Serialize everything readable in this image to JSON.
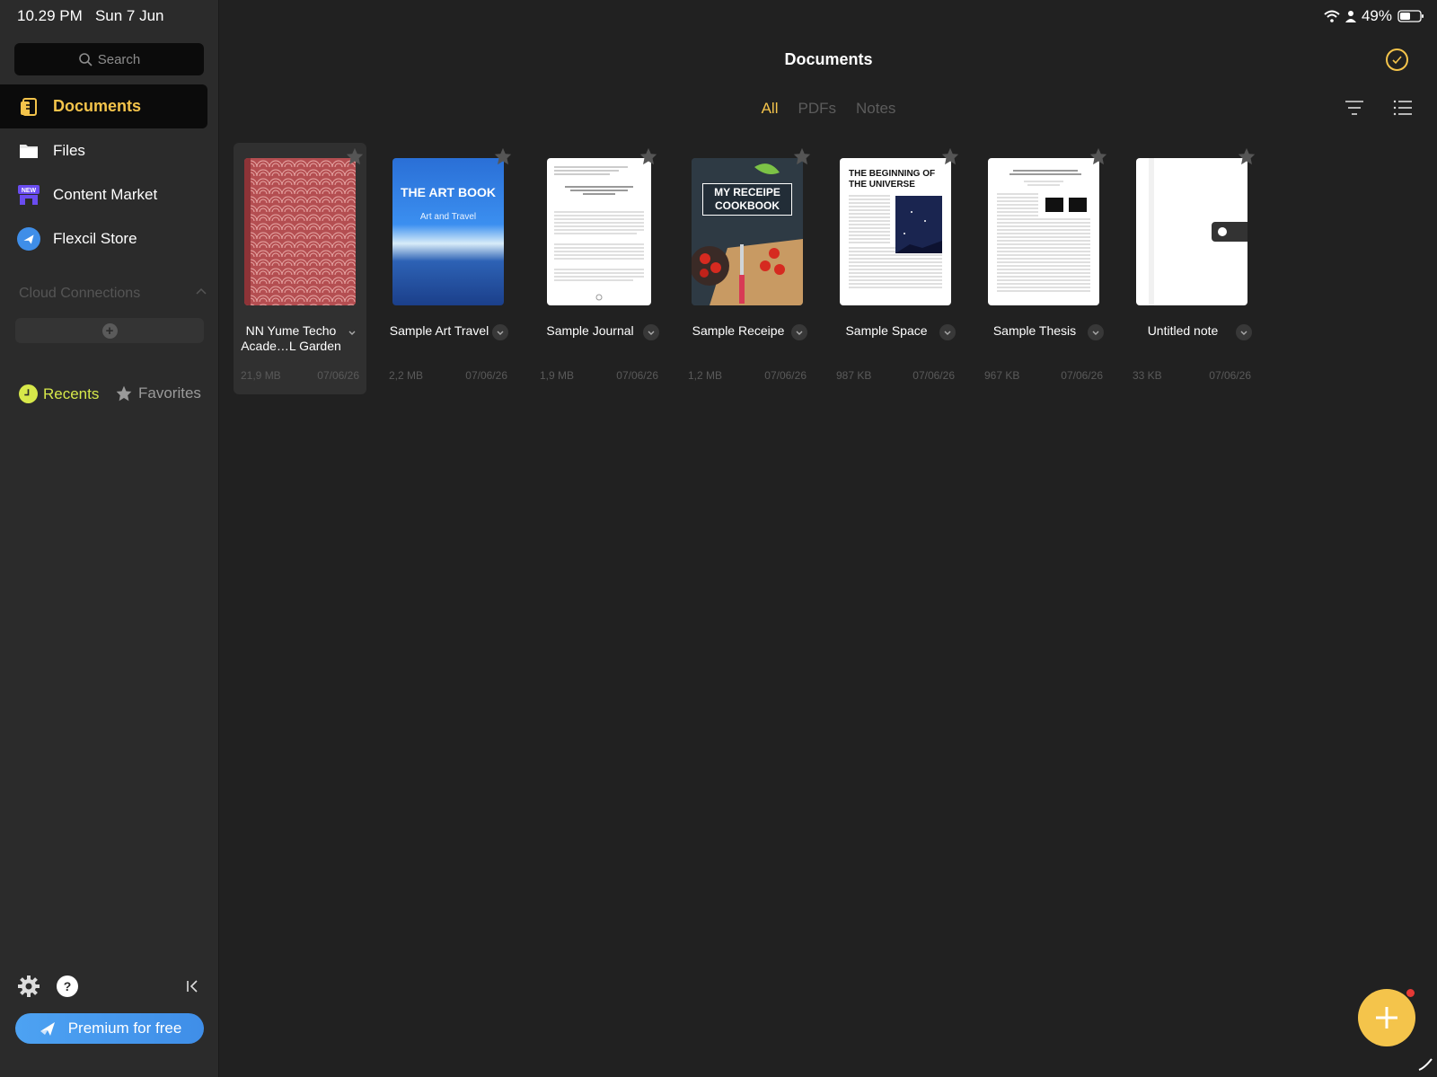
{
  "status": {
    "time": "10.29 PM",
    "date": "Sun 7 Jun",
    "battery": "49%"
  },
  "sidebar": {
    "search_placeholder": "Search",
    "items": [
      {
        "label": "Documents",
        "icon": "documents-icon",
        "active": true
      },
      {
        "label": "Files",
        "icon": "folder-icon"
      },
      {
        "label": "Content Market",
        "icon": "market-new-icon"
      },
      {
        "label": "Flexcil Store",
        "icon": "store-icon"
      }
    ],
    "cloud_label": "Cloud Connections",
    "recents_label": "Recents",
    "favorites_label": "Favorites",
    "premium_label": "Premium for free"
  },
  "header": {
    "title": "Documents",
    "tabs": [
      "All",
      "PDFs",
      "Notes"
    ]
  },
  "documents": [
    {
      "name": "NN Yume Techo Acade…L Garden",
      "size": "21,9 MB",
      "date": "07/06/26"
    },
    {
      "name": "Sample Art Travel",
      "size": "2,2 MB",
      "date": "07/06/26",
      "cover_title": "THE ART BOOK",
      "cover_sub": "Art and Travel"
    },
    {
      "name": "Sample Journal",
      "size": "1,9 MB",
      "date": "07/06/26"
    },
    {
      "name": "Sample Receipe",
      "size": "1,2 MB",
      "date": "07/06/26",
      "cover_title": "MY RECEIPE COOKBOOK"
    },
    {
      "name": "Sample Space",
      "size": "987 KB",
      "date": "07/06/26",
      "cover_title": "THE BEGINNING OF THE UNIVERSE"
    },
    {
      "name": "Sample Thesis",
      "size": "967 KB",
      "date": "07/06/26"
    },
    {
      "name": "Untitled note",
      "size": "33 KB",
      "date": "07/06/26"
    }
  ]
}
